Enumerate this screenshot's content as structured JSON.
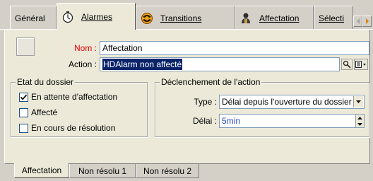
{
  "tabs": [
    {
      "label": "Général",
      "icon": "none"
    },
    {
      "label": "Alarmes",
      "icon": "stopwatch-icon"
    },
    {
      "label": "Transitions",
      "icon": "transitions-icon"
    },
    {
      "label": "Affectation",
      "icon": "user-icon"
    },
    {
      "label": "Sélecti",
      "icon": "none"
    }
  ],
  "form": {
    "nom_label": "Nom :",
    "nom_value": "Affectation",
    "action_label": "Action :",
    "action_value": "HDAlarm non affecté"
  },
  "etat": {
    "title": "Etat du dossier",
    "options": [
      {
        "label": "En attente d'affectation",
        "checked": true
      },
      {
        "label": "Affecté",
        "checked": false
      },
      {
        "label": "En cours de résolution",
        "checked": false
      }
    ]
  },
  "declenchement": {
    "title": "Déclenchement de l'action",
    "type_label": "Type :",
    "type_value": "Délai depuis l'ouverture du dossier",
    "delai_label": "Délai :",
    "delai_value": "5min"
  },
  "bottom_tabs": [
    {
      "label": "Affectation",
      "selected": true
    },
    {
      "label": "Non résolu 1",
      "selected": false
    },
    {
      "label": "Non résolu 2",
      "selected": false
    }
  ],
  "colors": {
    "required_label": "#e40000",
    "selection_bg": "#0a246a",
    "spin_value": "#2448c8"
  }
}
